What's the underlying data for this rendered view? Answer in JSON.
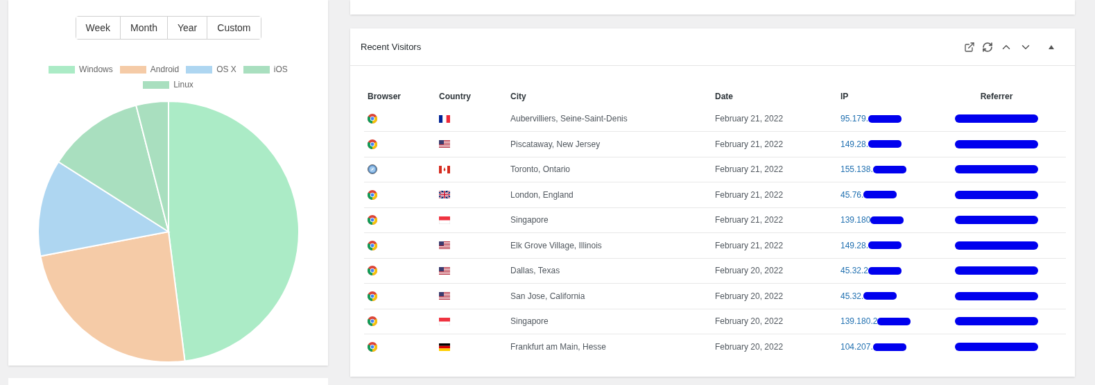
{
  "range_buttons": [
    "Week",
    "Month",
    "Year",
    "Custom"
  ],
  "legend": [
    {
      "label": "Windows",
      "color": "#abebc6"
    },
    {
      "label": "Android",
      "color": "#f5cba7"
    },
    {
      "label": "OS X",
      "color": "#aed6f1"
    },
    {
      "label": "iOS",
      "color": "#a9dfbf"
    },
    {
      "label": "Linux",
      "color": "#a9dfbf"
    }
  ],
  "visitors": {
    "title": "Recent Visitors",
    "columns": [
      "Browser",
      "Country",
      "City",
      "Date",
      "IP",
      "Referrer"
    ],
    "rows": [
      {
        "browser": {
          "kind": "chrome"
        },
        "country": {
          "kind": "fr"
        },
        "city": "Aubervilliers, Seine-Saint-Denis",
        "date": "February 21, 2022",
        "ip": "95.179.",
        "redacted": true
      },
      {
        "browser": {
          "kind": "chrome"
        },
        "country": {
          "kind": "us"
        },
        "city": "Piscataway, New Jersey",
        "date": "February 21, 2022",
        "ip": "149.28.",
        "redacted": true
      },
      {
        "browser": {
          "kind": "safari"
        },
        "country": {
          "kind": "ca"
        },
        "city": "Toronto, Ontario",
        "date": "February 21, 2022",
        "ip": "155.138.",
        "redacted": true
      },
      {
        "browser": {
          "kind": "chrome"
        },
        "country": {
          "kind": "gb"
        },
        "city": "London, England",
        "date": "February 21, 2022",
        "ip": "45.76.",
        "redacted": true
      },
      {
        "browser": {
          "kind": "chrome"
        },
        "country": {
          "kind": "sg"
        },
        "city": "Singapore",
        "date": "February 21, 2022",
        "ip": "139.180",
        "redacted": true
      },
      {
        "browser": {
          "kind": "chrome"
        },
        "country": {
          "kind": "us"
        },
        "city": "Elk Grove Village, Illinois",
        "date": "February 21, 2022",
        "ip": "149.28.",
        "redacted": true
      },
      {
        "browser": {
          "kind": "chrome"
        },
        "country": {
          "kind": "us"
        },
        "city": "Dallas, Texas",
        "date": "February 20, 2022",
        "ip": "45.32.2",
        "redacted": true
      },
      {
        "browser": {
          "kind": "chrome"
        },
        "country": {
          "kind": "us"
        },
        "city": "San Jose, California",
        "date": "February 20, 2022",
        "ip": "45.32.",
        "redacted": true
      },
      {
        "browser": {
          "kind": "chrome"
        },
        "country": {
          "kind": "sg"
        },
        "city": "Singapore",
        "date": "February 20, 2022",
        "ip": "139.180.2",
        "redacted": true
      },
      {
        "browser": {
          "kind": "chrome"
        },
        "country": {
          "kind": "de"
        },
        "city": "Frankfurt am Main, Hesse",
        "date": "February 20, 2022",
        "ip": "104.207.",
        "redacted": true
      }
    ]
  }
}
